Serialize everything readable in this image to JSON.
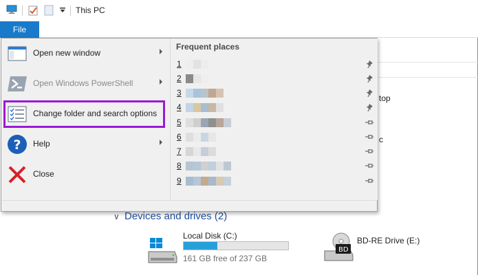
{
  "window": {
    "title": "This PC",
    "file_tab_label": "File"
  },
  "file_menu": {
    "items": [
      {
        "label": "Open new window",
        "icon": "new-window-icon",
        "has_submenu": true,
        "enabled": true
      },
      {
        "label": "Open Windows PowerShell",
        "icon": "powershell-icon",
        "has_submenu": true,
        "enabled": false
      },
      {
        "label": "Change folder and search options",
        "icon": "folder-options-icon",
        "has_submenu": false,
        "enabled": true,
        "highlighted": true
      },
      {
        "label": "Help",
        "icon": "help-icon",
        "has_submenu": true,
        "enabled": true
      },
      {
        "label": "Close",
        "icon": "close-icon",
        "has_submenu": false,
        "enabled": true
      }
    ],
    "highlight_color": "#9b19d6"
  },
  "frequent_places": {
    "heading": "Frequent places",
    "rows": [
      {
        "number": "1",
        "pinned": true
      },
      {
        "number": "2",
        "pinned": true
      },
      {
        "number": "3",
        "pinned": true
      },
      {
        "number": "4",
        "pinned": true
      },
      {
        "number": "5",
        "pinned": false
      },
      {
        "number": "6",
        "pinned": false
      },
      {
        "number": "7",
        "pinned": false
      },
      {
        "number": "8",
        "pinned": false
      },
      {
        "number": "9",
        "pinned": false
      }
    ]
  },
  "background": {
    "fragment_top": "top",
    "fragment_mid": "c",
    "section_title": "Devices and drives (2)",
    "drives": [
      {
        "name": "Local Disk (C:)",
        "free_text": "161 GB free of 237 GB",
        "used_fraction": 0.32,
        "icon": "windows-drive-icon"
      },
      {
        "name": "BD-RE Drive (E:)",
        "icon": "bd-drive-icon"
      }
    ]
  },
  "colors": {
    "accent": "#1979ca",
    "progress": "#26a0da"
  }
}
